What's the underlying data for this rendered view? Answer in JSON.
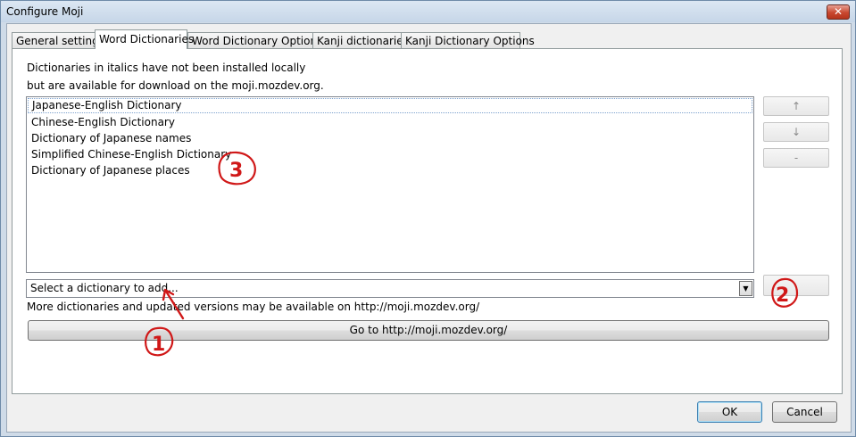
{
  "window": {
    "title": "Configure Moji",
    "close_glyph": "✕"
  },
  "tabs": [
    {
      "label": "General settings",
      "active": false
    },
    {
      "label": "Word Dictionaries",
      "active": true
    },
    {
      "label": "Word Dictionary Options",
      "active": false
    },
    {
      "label": "Kanji dictionaries",
      "active": false
    },
    {
      "label": "Kanji Dictionary Options",
      "active": false
    }
  ],
  "panel": {
    "info_line1": "Dictionaries in italics have not been installed locally",
    "info_line2": "but are available for download on the moji.mozdev.org.",
    "dictionaries": [
      "Japanese-English Dictionary",
      "Chinese-English Dictionary",
      "Dictionary of Japanese names",
      "Simplified Chinese-English Dictionary",
      "Dictionary of Japanese places"
    ],
    "move_up_label": "↑",
    "move_down_label": "↓",
    "remove_label": "-",
    "add_label": "",
    "add_select_value": "Select a dictionary to add...",
    "more_info": "More dictionaries and updated versions may be available on http://moji.mozdev.org/",
    "goto_label": "Go to http://moji.mozdev.org/"
  },
  "dialog": {
    "ok_label": "OK",
    "cancel_label": "Cancel"
  },
  "annotations": {
    "one": "1",
    "two": "2",
    "three": "3",
    "color": "#d01818"
  }
}
